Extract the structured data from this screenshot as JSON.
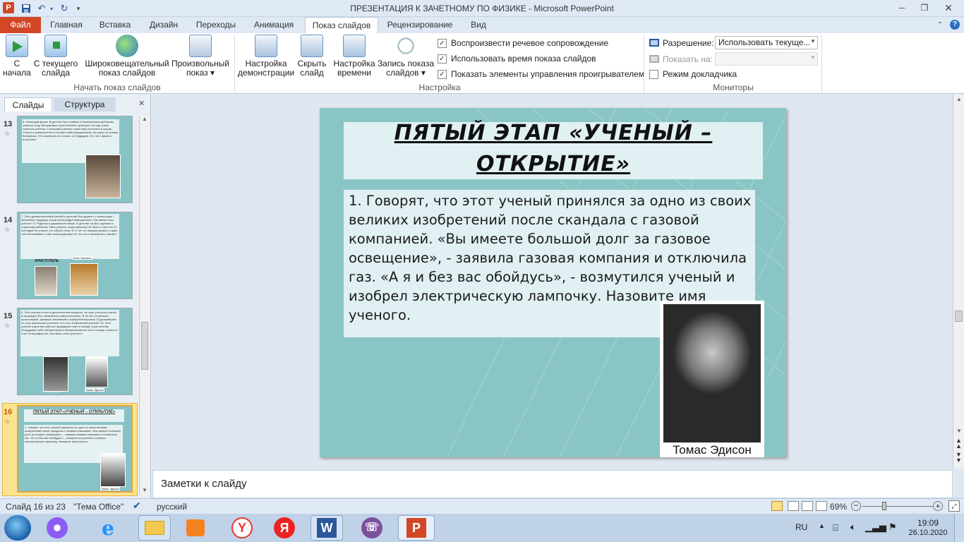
{
  "app": {
    "window_title": "ПРЕЗЕНТАЦИЯ К ЗАЧЕТНОМУ ПО ФИЗИКЕ  -  Microsoft PowerPoint",
    "app_icon": "P"
  },
  "tabs": [
    {
      "label": "Файл"
    },
    {
      "label": "Главная"
    },
    {
      "label": "Вставка"
    },
    {
      "label": "Дизайн"
    },
    {
      "label": "Переходы"
    },
    {
      "label": "Анимация"
    },
    {
      "label": "Показ слайдов"
    },
    {
      "label": "Рецензирование"
    },
    {
      "label": "Вид"
    }
  ],
  "ribbon": {
    "start_group": {
      "label": "Начать показ слайдов",
      "from_start": [
        "С",
        "начала"
      ],
      "from_current": [
        "С текущего",
        "слайда"
      ],
      "broadcast": [
        "Широковещательный",
        "показ слайдов"
      ],
      "custom": [
        "Произвольный",
        "показ ▾"
      ]
    },
    "setup_group": {
      "label": "Настройка",
      "setup": [
        "Настройка",
        "демонстрации"
      ],
      "hide": [
        "Скрыть",
        "слайд"
      ],
      "rehearse": [
        "Настройка",
        "времени"
      ],
      "record": [
        "Запись показа",
        "слайдов ▾"
      ],
      "play_narrations": "Воспроизвести речевое сопровождение",
      "use_timings": "Использовать время показа слайдов",
      "show_controls": "Показать элементы управления проигрывателем"
    },
    "monitors_group": {
      "label": "Мониторы",
      "resolution_label": "Разрешение:",
      "resolution_value": "Использовать текуще...",
      "show_on_label": "Показать на:",
      "show_on_value": "",
      "presenter_view": "Режим докладчика"
    }
  },
  "left_pane": {
    "tab_slides": "Слайды",
    "tab_outline": "Структура",
    "close": "✕",
    "slides": [
      {
        "number": "13",
        "text": "6. Немецкий физик. В детстве был слабым и болезненным ребенком, помогал отцу обслуживать посетителей в трактире. Но ему очень хотелось учиться, и сельский учитель помог ему поступить в школу. Учился в университете и готовил себя священником, он узнал об учении Коперника. Это изменило его планы, и в будущем. Кто этот физик и астроном?"
      },
      {
        "number": "14",
        "text": "7. Этот древнегреческий ученый в детстве был дружен с сыном царя – Филиппом, будущим отцом Александра Македонского. Как звали этого ученого?\n8. Родился в дворянской семье. В детстве он был хрупким и странным ребенком. Мать умерла, когда мальчику не было и трех лет. В колледже не учился, его обучал отец. В 17 лет он первым пришел к идее счетной машины и сам сконструировал ее. Кто этот математик и физик?",
        "captions": [
          "АРИСТОТЕЛЬ",
          "Блез Паскаль"
        ]
      },
      {
        "number": "15",
        "text": "9. Этот ученый оглох в десятилетнем возрасте, не смог учиться в школе и вынужден был заниматься самостоятельно. В 16 лет он увлекся астрономией, физикой, механикой и изобретательством. В дальнейшем он стал школьным учителем. Кто этот знаменитый ученый?\n10. Этот ученый в детстве работал продавцом газет в поезде и для опытов оборудовал себе лабораторию в багажном вагоне этого поезда, затем он стал телеграфистом. Как звали этого ученого?",
        "captions": [
          "К.Э.Циолковский",
          "Томас Эдисон"
        ]
      },
      {
        "number": "16",
        "title": "ПЯТЫЙ ЭТАП «УЧЕНЫЙ – ОТКРЫТИЕ»",
        "text": "1. Говорят, что этот ученый принялся за одно из своих великих изобретений после скандала с газовой компанией. «Вы имеете большой долг за газовое освещение», - заявила газовая компания и отключила газ. «А я и без вас обойдусь», - возмутился ученый и изобрел электрическую лампочку. Назовите имя ученого.",
        "captions": [
          "Томас Эдисон"
        ]
      }
    ]
  },
  "slide": {
    "title": "ПЯТЫЙ ЭТАП «УЧЕНЫЙ – ОТКРЫТИЕ»",
    "body": "1. Говорят, что этот ученый принялся за одно из своих великих изобретений после скандала с газовой компанией. «Вы имеете большой долг за газовое освещение», - заявила газовая компания и отключила газ. «А я и без вас обойдусь», - возмутился ученый и изобрел электрическую лампочку. Назовите имя ученого.",
    "photo_caption": "Томас Эдисон",
    "background_color": "#8ac5c5"
  },
  "notes": {
    "placeholder": "Заметки к слайду"
  },
  "status": {
    "slide_info": "Слайд 16 из 23",
    "theme": "\"Тема Office\"",
    "language": "русский",
    "zoom": "69%"
  },
  "taskbar": {
    "lang": "RU",
    "time": "19:09",
    "date": "26.10.2020",
    "apps": [
      "start-orb",
      "alice-assistant",
      "internet-explorer",
      "file-explorer",
      "media-player",
      "yandex-browser",
      "yandex",
      "word",
      "viber",
      "powerpoint"
    ]
  }
}
